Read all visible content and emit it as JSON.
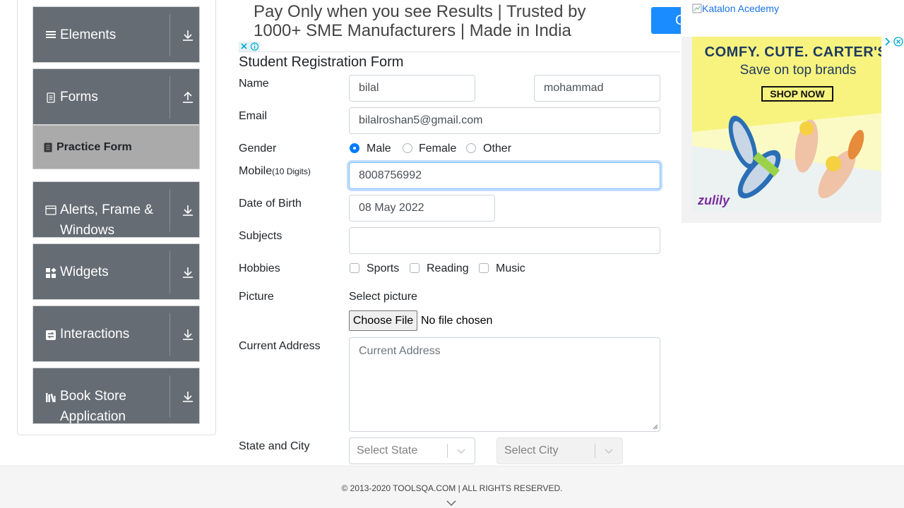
{
  "sidebar": {
    "groups": [
      {
        "label": "Elements",
        "icon": "hamburger-icon",
        "chevron": "download-arrow-icon"
      },
      {
        "label": "Forms",
        "icon": "document-icon",
        "chevron": "upload-arrow-icon"
      },
      {
        "label_line1": "Alerts, Frame &",
        "label_line2": "Windows",
        "icon": "window-icon",
        "chevron": "download-arrow-icon"
      },
      {
        "label": "Widgets",
        "icon": "widgets-icon",
        "chevron": "download-arrow-icon"
      },
      {
        "label": "Interactions",
        "icon": "interactions-icon",
        "chevron": "download-arrow-icon"
      },
      {
        "label_line1": "Book Store",
        "label_line2": "Application",
        "icon": "books-icon",
        "chevron": "download-arrow-icon"
      }
    ],
    "active_item": {
      "label": "Practice Form",
      "icon": "form-icon"
    }
  },
  "top_ad": {
    "text_line1": "Pay Only when you see Results | Trusted by",
    "text_line2": "1000+ SME Manufacturers | Made in India",
    "button_label": "O"
  },
  "form": {
    "title": "Student Registration Form",
    "name_label": "Name",
    "first_name": "bilal",
    "last_name": "mohammad",
    "email_label": "Email",
    "email": "bilalroshan5@gmail.com",
    "gender_label": "Gender",
    "gender_options": [
      "Male",
      "Female",
      "Other"
    ],
    "gender_selected": "Male",
    "mobile_label": "Mobile",
    "mobile_hint": "(10 Digits)",
    "mobile": "8008756992",
    "dob_label": "Date of Birth",
    "dob": "08 May 2022",
    "subjects_label": "Subjects",
    "subjects": "",
    "hobbies_label": "Hobbies",
    "hobbies": [
      "Sports",
      "Reading",
      "Music"
    ],
    "picture_label": "Picture",
    "select_picture": "Select picture",
    "choose_file": "Choose File",
    "no_file": "No file chosen",
    "address_label": "Current Address",
    "address_placeholder": "Current Address",
    "state_city_label": "State and City",
    "state_placeholder": "Select State",
    "city_placeholder": "Select City"
  },
  "right_ad": {
    "katalon_alt": "Katalon Acedemy",
    "headline": "COMFY. CUTE. CARTER'S.",
    "subline": "Save on top brands",
    "cta": "SHOP NOW",
    "brand": "zulily"
  },
  "footer": {
    "copyright": "© 2013-2020 TOOLSQA.COM | ALL RIGHTS RESERVED."
  },
  "colors": {
    "sidebar_bg": "#656c74",
    "active_bg": "#aaaaaa",
    "primary": "#007bff",
    "ad_yellow": "#f7f37e"
  }
}
